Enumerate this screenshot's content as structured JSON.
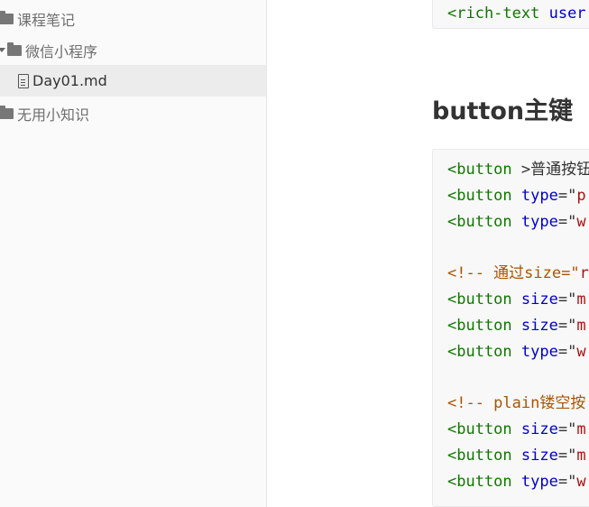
{
  "sidebar": {
    "items": [
      {
        "label": "课程笔记",
        "icon": "folder-icon"
      },
      {
        "label": "微信小程序",
        "icon": "folder-icon",
        "expanded": true
      },
      {
        "label": "Day01.md",
        "icon": "file-icon",
        "active": true
      },
      {
        "label": "无用小知识",
        "icon": "folder-icon"
      }
    ]
  },
  "main": {
    "top_code": {
      "line1_tag": "<rich-text",
      "line1_attr": " user"
    },
    "heading": "button主键",
    "code": {
      "l1_tag": "<button ",
      "l1_txt": ">普通按钮",
      "l2_tag": "<button ",
      "l2_attr": "type",
      "l2_eq": "=\"",
      "l2_str": "p",
      "l3_tag": "<button ",
      "l3_attr": "type",
      "l3_eq": "=\"",
      "l3_str": "w",
      "l4_cmt": "<!-- 通过size=\"",
      "l4_str": "r",
      "l5_tag": "<button ",
      "l5_attr": "size",
      "l5_eq": "=\"",
      "l5_str": "m",
      "l6_tag": "<button ",
      "l6_attr": "size",
      "l6_eq": "=\"",
      "l6_str": "m",
      "l7_tag": "<button ",
      "l7_attr": "type",
      "l7_eq": "=\"",
      "l7_str": "w",
      "l8_cmt": "<!-- plain镂空按",
      "l9_tag": "<button ",
      "l9_attr": "size",
      "l9_eq": "=\"",
      "l9_str": "m",
      "l10_tag": "<button ",
      "l10_attr": "size",
      "l10_eq": "=\"",
      "l10_str": "m",
      "l11_tag": "<button ",
      "l11_attr": "type",
      "l11_eq": "=\"",
      "l11_str": "w"
    }
  }
}
